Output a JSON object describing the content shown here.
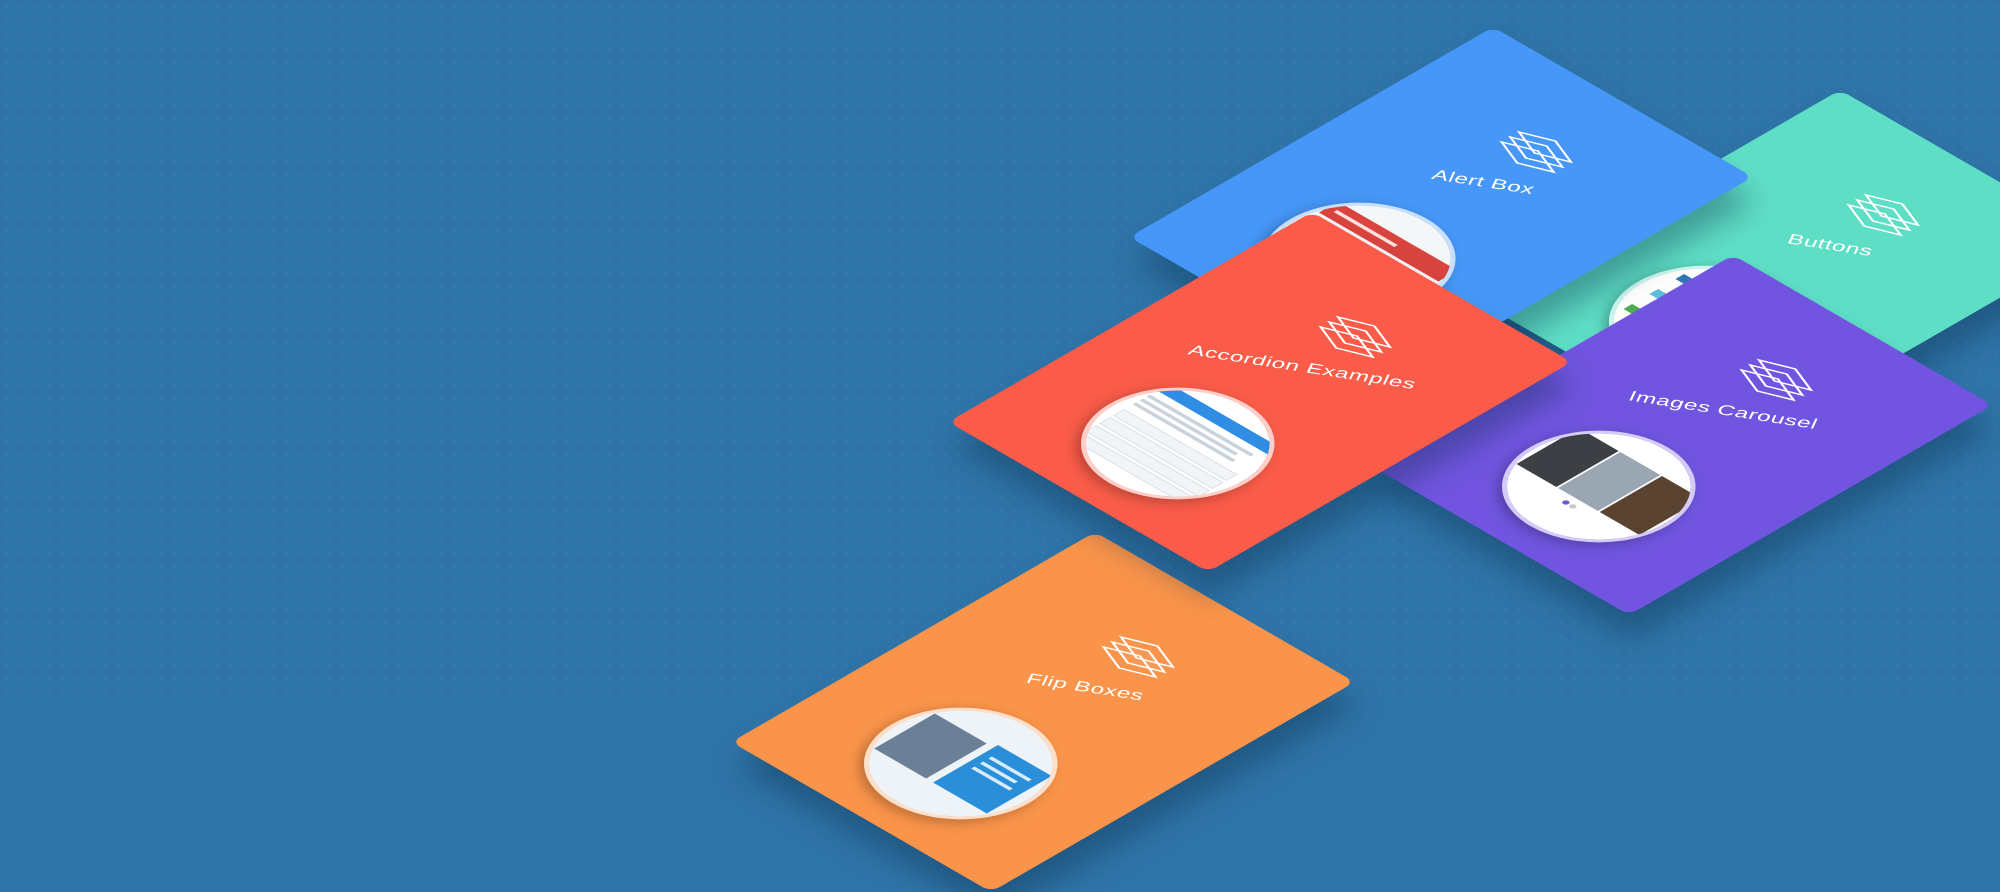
{
  "cards": [
    {
      "title": "Flip Boxes",
      "color": "#fa944a"
    },
    {
      "title": "Accordion Examples",
      "color": "#fa5c49"
    },
    {
      "title": "Alert Box",
      "color": "#4697f7"
    },
    {
      "title": "Images Carousel",
      "color": "#7155e0"
    },
    {
      "title": "Buttons",
      "color": "#5fdec6"
    }
  ],
  "icon": "layers-icon"
}
